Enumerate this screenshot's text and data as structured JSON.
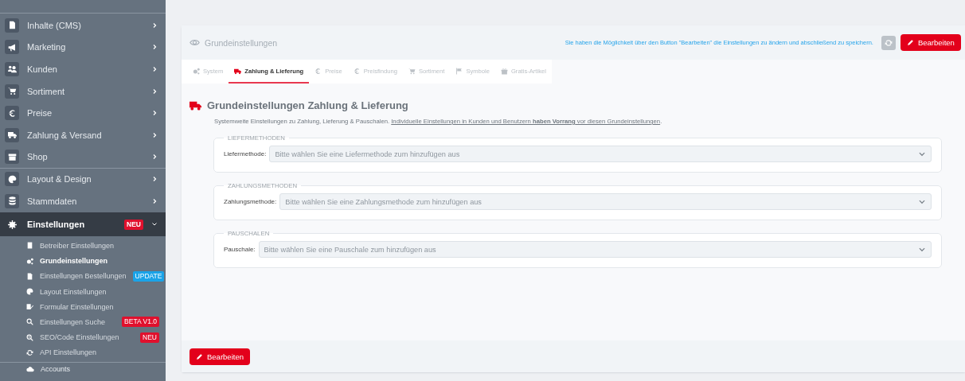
{
  "sidebar": {
    "items": [
      {
        "label": "Inhalte (CMS)",
        "expanded": false,
        "selected": false
      },
      {
        "label": "Marketing",
        "expanded": false,
        "selected": false
      },
      {
        "label": "Kunden",
        "expanded": false,
        "selected": false
      },
      {
        "label": "Sortiment",
        "expanded": false,
        "selected": false
      },
      {
        "label": "Preise",
        "expanded": false,
        "selected": false
      },
      {
        "label": "Zahlung & Versand",
        "expanded": false,
        "selected": false
      },
      {
        "label": "Shop",
        "expanded": false,
        "selected": false
      },
      {
        "label": "Layout & Design",
        "expanded": false,
        "selected": false
      },
      {
        "label": "Stammdaten",
        "expanded": false,
        "selected": false
      },
      {
        "label": "Einstellungen",
        "expanded": true,
        "selected": true,
        "badge": {
          "text": "NEU",
          "color": "#e0102d"
        },
        "children": [
          {
            "label": "Betreiber Einstellungen",
            "selected": false
          },
          {
            "label": "Grundeinstellungen",
            "selected": true
          },
          {
            "label": "Einstellungen Bestellungen",
            "selected": false,
            "badge": {
              "text": "UPDATE",
              "color": "#1aa3e8"
            }
          },
          {
            "label": "Layout Einstellungen",
            "selected": false
          },
          {
            "label": "Formular Einstellungen",
            "selected": false
          },
          {
            "label": "Einstellungen Suche",
            "selected": false,
            "badge": {
              "text": "BETA V1.0",
              "color": "#e0102d"
            }
          },
          {
            "label": "SEO/Code Einstellungen",
            "selected": false,
            "badge": {
              "text": "NEU",
              "color": "#e0102d"
            }
          },
          {
            "label": "API Einstellungen",
            "selected": false
          }
        ]
      },
      {
        "label": "Accounts",
        "selected": false,
        "kind": "sub"
      }
    ]
  },
  "header": {
    "title": "Grundeinstellungen",
    "hint": "Sie haben die Möglichkeit über den Button \"Bearbeiten\" die Einstellungen zu ändern und abschließend zu speichern.",
    "button": "Bearbeiten"
  },
  "tabs": [
    {
      "label": "System",
      "selected": false
    },
    {
      "label": "Zahlung & Lieferung",
      "selected": true
    },
    {
      "label": "Preise",
      "selected": false
    },
    {
      "label": "Preisfindung",
      "selected": false
    },
    {
      "label": "Sortiment",
      "selected": false
    },
    {
      "label": "Symbole",
      "selected": false
    },
    {
      "label": "Gratis-Artikel",
      "selected": false
    }
  ],
  "section": {
    "title": "Grundeinstellungen Zahlung & Lieferung",
    "description": "Systemweite Einstellungen zu Zahlung, Lieferung & Pauschalen.",
    "link": "Individuelle Einstellungen in Kunden und Benutzern **haben Vorrang** vor diesen Grundeinstellungen",
    "end": "."
  },
  "groups": [
    {
      "legend": "LIEFERMETHODEN",
      "label": "Liefermethode:",
      "placeholder": "Bitte wählen Sie eine Liefermethode zum hinzufügen aus"
    },
    {
      "legend": "ZAHLUNGSMETHODEN",
      "label": "Zahlungsmethode:",
      "placeholder": "Bitte wählen Sie eine Zahlungsmethode zum hinzufügen aus"
    },
    {
      "legend": "PAUSCHALEN",
      "label": "Pauschale:",
      "placeholder": "Bitte wählen Sie eine Pauschale zum hinzufügen aus"
    }
  ],
  "footer": {
    "button": "Bearbeiten"
  }
}
